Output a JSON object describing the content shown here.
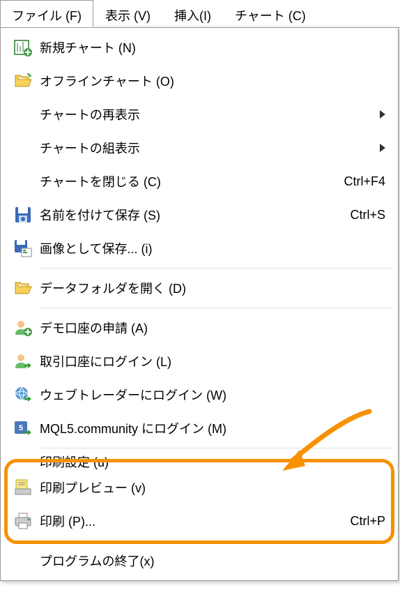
{
  "menubar": {
    "items": [
      {
        "label": "ファイル (F)",
        "active": true
      },
      {
        "label": "表示 (V)"
      },
      {
        "label": "挿入(I)"
      },
      {
        "label": "チャート (C)"
      }
    ]
  },
  "menu": {
    "items": [
      {
        "icon": "new-chart",
        "label": "新規チャート (N)"
      },
      {
        "icon": "folder-open-green",
        "label": "オフラインチャート (O)"
      },
      {
        "icon": "",
        "label": "チャートの再表示",
        "submenu": true
      },
      {
        "icon": "",
        "label": "チャートの組表示",
        "submenu": true
      },
      {
        "icon": "",
        "label": "チャートを閉じる (C)",
        "shortcut": "Ctrl+F4"
      },
      {
        "icon": "save",
        "label": "名前を付けて保存 (S)",
        "shortcut": "Ctrl+S"
      },
      {
        "icon": "save-image",
        "label": "画像として保存... (i)"
      },
      {
        "separator": true
      },
      {
        "icon": "folder-open-yellow",
        "label": "データフォルダを開く (D)"
      },
      {
        "separator": true
      },
      {
        "icon": "user-add",
        "label": "デモ口座の申請 (A)"
      },
      {
        "icon": "user-login",
        "label": "取引口座にログイン (L)"
      },
      {
        "icon": "globe",
        "label": "ウェブトレーダーにログイン (W)"
      },
      {
        "icon": "mql5",
        "label": "MQL5.community にログイン (M)"
      },
      {
        "separator": true
      },
      {
        "icon": "",
        "label": "印刷設定 (u)",
        "truncated": true
      },
      {
        "icon": "print-preview",
        "label": "印刷プレビュー (v)"
      },
      {
        "icon": "printer",
        "label": "印刷 (P)...",
        "shortcut": "Ctrl+P"
      },
      {
        "separator": true
      },
      {
        "icon": "",
        "label": "プログラムの終了(x)"
      }
    ]
  }
}
